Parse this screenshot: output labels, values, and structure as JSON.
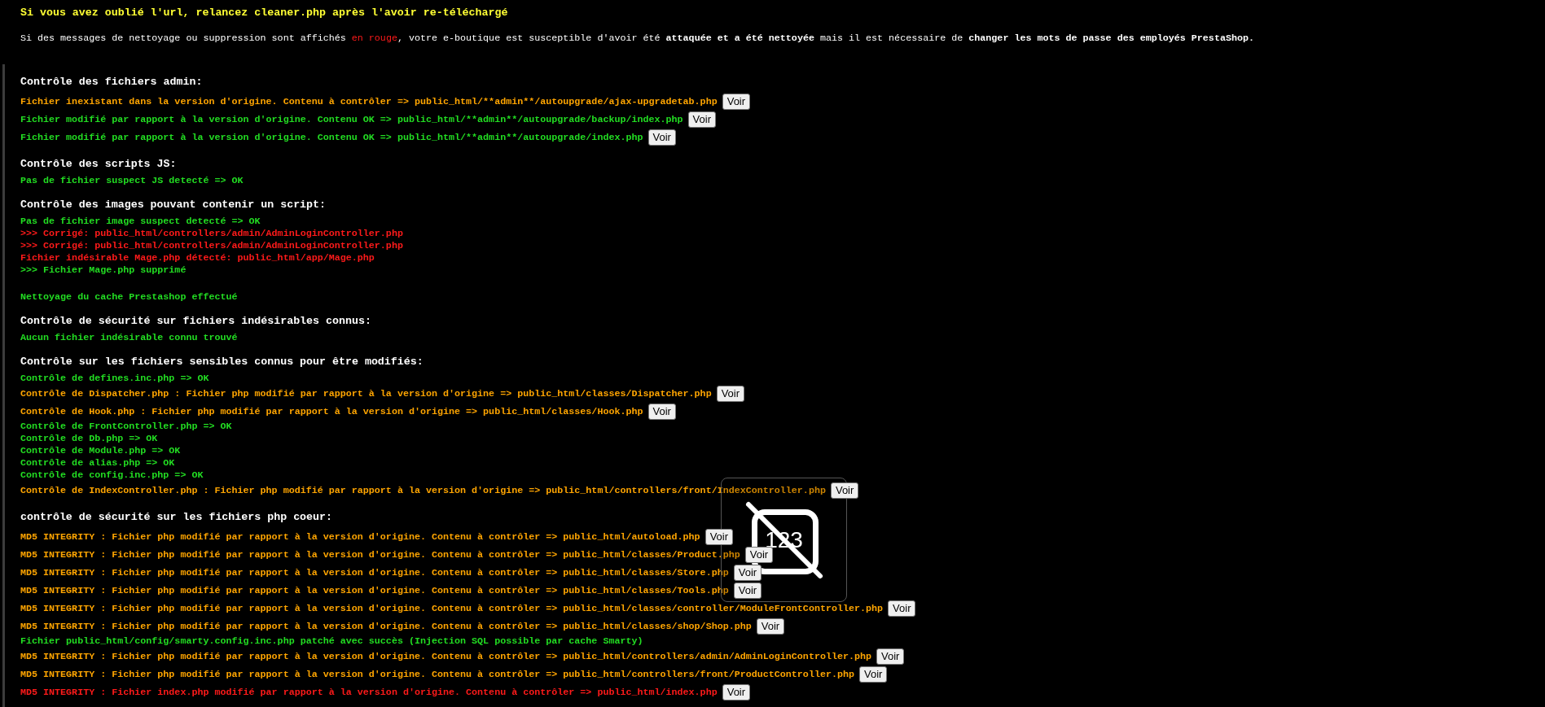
{
  "notice_lines": [
    "Si vous avez oublié l'url, relancez cleaner.php après l'avoir re-téléchargé"
  ],
  "intro": [
    {
      "text": "Si des messages de nettoyage ou suppression sont affichés ",
      "color": "#ffffff"
    },
    {
      "text": "en rouge",
      "color": "#ff1a1a"
    },
    {
      "text": ", votre e-boutique est susceptible d'avoir été **attaquée et a été nettoyée** mais il est nécessaire de **changer les mots de passe des employés PrestaShop.**",
      "color": "#ffffff"
    }
  ],
  "sections": [
    {
      "heading": "Contrôle des fichiers admin:",
      "lines": [
        {
          "text": "Fichier inexistant dans la version d'origine. Contenu à contrôler => public_html/**admin**/autoupgrade/ajax-upgradetab.php",
          "color": "#ffa500",
          "button": "Voir"
        },
        {
          "text": "Fichier modifié par rapport à la version d'origine. Contenu OK => public_html/**admin**/autoupgrade/backup/index.php",
          "color": "#22dd22",
          "button": "Voir"
        },
        {
          "text": "Fichier modifié par rapport à la version d'origine. Contenu OK => public_html/**admin**/autoupgrade/index.php",
          "color": "#22dd22",
          "button": "Voir"
        }
      ]
    },
    {
      "heading": "Contrôle des scripts JS:",
      "lines": [
        {
          "text": "Pas de fichier suspect JS detecté => OK",
          "color": "#22dd22"
        }
      ]
    },
    {
      "heading": "Contrôle des images pouvant contenir un script:",
      "lines": [
        {
          "text": "Pas de fichier image suspect detecté => OK",
          "color": "#22dd22"
        },
        {
          "text": ">>> Corrigé: public_html/controllers/admin/AdminLoginController.php",
          "color": "#ff1a1a"
        },
        {
          "text": ">>> Corrigé: public_html/controllers/admin/AdminLoginController.php",
          "color": "#ff1a1a"
        },
        {
          "text": "Fichier indésirable Mage.php détecté: public_html/app/Mage.php",
          "color": "#ff1a1a"
        },
        {
          "text": ">>> Fichier Mage.php supprimé",
          "color": "#22dd22"
        }
      ]
    },
    {
      "lines": [
        {
          "text": "Nettoyage du cache Prestashop effectué",
          "color": "#22dd22"
        }
      ]
    },
    {
      "heading": "Contrôle de sécurité sur fichiers indésirables connus:",
      "lines": [
        {
          "text": "Aucun fichier indésirable connu trouvé",
          "color": "#22dd22"
        }
      ]
    },
    {
      "heading": "Contrôle sur les fichiers sensibles connus pour être modifiés:",
      "lines": [
        {
          "text": "Contrôle de defines.inc.php => OK",
          "color": "#22dd22"
        },
        {
          "text": "Contrôle de Dispatcher.php : Fichier php modifié par rapport à la version d'origine => public_html/classes/Dispatcher.php",
          "color": "#ffa500",
          "button": "Voir"
        },
        {
          "text": "Contrôle de Hook.php : Fichier php modifié par rapport à la version d'origine => public_html/classes/Hook.php",
          "color": "#ffa500",
          "button": "Voir"
        },
        {
          "text": "Contrôle de FrontController.php => OK",
          "color": "#22dd22"
        },
        {
          "text": "Contrôle de Db.php => OK",
          "color": "#22dd22"
        },
        {
          "text": "Contrôle de Module.php => OK",
          "color": "#22dd22"
        },
        {
          "text": "Contrôle de alias.php => OK",
          "color": "#22dd22"
        },
        {
          "text": "Contrôle de config.inc.php => OK",
          "color": "#22dd22"
        },
        {
          "text": "Contrôle de IndexController.php : Fichier php modifié par rapport à la version d'origine => public_html/controllers/front/IndexController.php",
          "color": "#ffa500",
          "button": "Voir"
        }
      ]
    },
    {
      "heading": "contrôle de sécurité sur les fichiers php coeur:",
      "lines": [
        {
          "text": "MD5 INTEGRITY : Fichier php modifié par rapport à la version d'origine. Contenu à contrôler => public_html/autoload.php",
          "color": "#ffa500",
          "button": "Voir"
        },
        {
          "text": "MD5 INTEGRITY : Fichier php modifié par rapport à la version d'origine. Contenu à contrôler => public_html/classes/Product.php",
          "color": "#ffa500",
          "button": "Voir"
        },
        {
          "text": "MD5 INTEGRITY : Fichier php modifié par rapport à la version d'origine. Contenu à contrôler => public_html/classes/Store.php",
          "color": "#ffa500",
          "button": "Voir"
        },
        {
          "text": "MD5 INTEGRITY : Fichier php modifié par rapport à la version d'origine. Contenu à contrôler => public_html/classes/Tools.php",
          "color": "#ffa500",
          "button": "Voir"
        },
        {
          "text": "MD5 INTEGRITY : Fichier php modifié par rapport à la version d'origine. Contenu à contrôler => public_html/classes/controller/ModuleFrontController.php",
          "color": "#ffa500",
          "button": "Voir"
        },
        {
          "text": "MD5 INTEGRITY : Fichier php modifié par rapport à la version d'origine. Contenu à contrôler => public_html/classes/shop/Shop.php",
          "color": "#ffa500",
          "button": "Voir"
        },
        {
          "text": "Fichier public_html/config/smarty.config.inc.php patché avec succès (Injection SQL possible par cache Smarty)",
          "color": "#22dd22"
        },
        {
          "text": "MD5 INTEGRITY : Fichier php modifié par rapport à la version d'origine. Contenu à contrôler => public_html/controllers/admin/AdminLoginController.php",
          "color": "#ffa500",
          "button": "Voir"
        },
        {
          "text": "MD5 INTEGRITY : Fichier php modifié par rapport à la version d'origine. Contenu à contrôler => public_html/controllers/front/ProductController.php",
          "color": "#ffa500",
          "button": "Voir"
        },
        {
          "text": "MD5 INTEGRITY : Fichier index.php modifié par rapport à la version d'origine. Contenu à contrôler => public_html/index.php",
          "color": "#ff1a1a",
          "button": "Voir"
        }
      ]
    }
  ],
  "numlock_overlay": {
    "label": "123"
  }
}
